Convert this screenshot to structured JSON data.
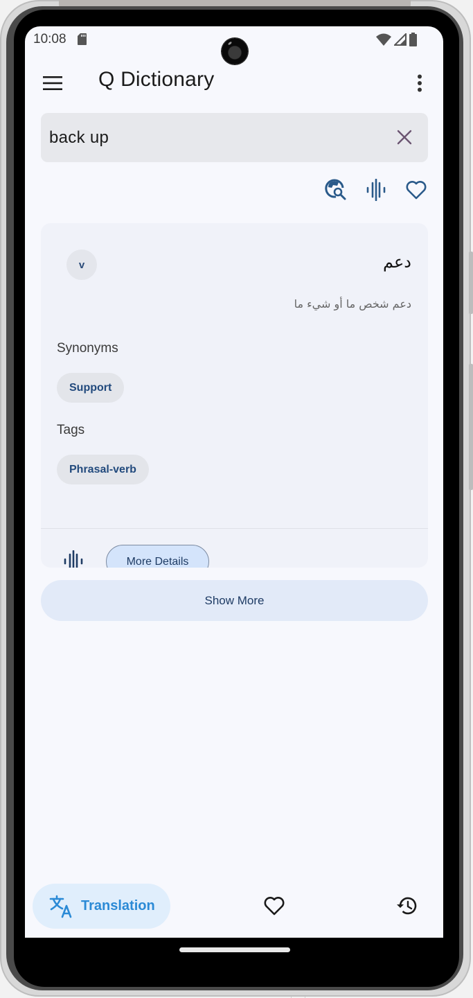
{
  "status_bar": {
    "time": "10:08",
    "icons": [
      "sd-card-icon",
      "wifi-icon",
      "signal-icon",
      "battery-icon"
    ]
  },
  "app_bar": {
    "title": "Q Dictionary",
    "menu_icon": "hamburger-menu-icon",
    "overflow_icon": "more-vert-icon"
  },
  "search": {
    "value": "back up",
    "placeholder": "",
    "clear_icon": "close-icon",
    "clear_color": "#6b5471"
  },
  "actions": [
    {
      "name": "web-search",
      "icon": "travel-explore-icon"
    },
    {
      "name": "pronounce",
      "icon": "audio-wave-icon"
    },
    {
      "name": "favorite",
      "icon": "heart-outline-icon"
    }
  ],
  "result_card": {
    "part_of_speech": "v",
    "translation": "دعم",
    "definition": "دعم شخص ما أو شيء ما",
    "synonyms_label": "Synonyms",
    "synonyms": [
      "Support"
    ],
    "tags_label": "Tags",
    "tags": [
      "Phrasal-verb"
    ],
    "audio_icon": "audio-wave-icon",
    "more_details_label": "More Details"
  },
  "show_more_label": "Show More",
  "bottom_nav": {
    "items": [
      {
        "label": "Translation",
        "icon": "translate-icon",
        "active": true
      },
      {
        "label": "",
        "icon": "heart-outline-icon",
        "active": false
      },
      {
        "label": "",
        "icon": "history-icon",
        "active": false
      }
    ]
  },
  "colors": {
    "accent": "#2b8ad6",
    "icon_blue": "#2a5a8a",
    "chip_text": "#224a7d",
    "background": "#f7f8fd"
  }
}
